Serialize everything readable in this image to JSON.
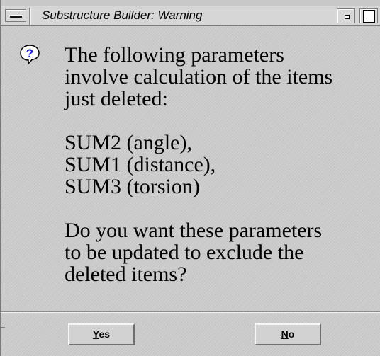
{
  "window": {
    "title": "Substructure Builder: Warning"
  },
  "icons": {
    "question": "question-icon",
    "question_glyph": "?",
    "question_color": "#1f1fd8"
  },
  "message": {
    "line1": "The following parameters",
    "line2": "involve calculation of the items",
    "line3": "just deleted:",
    "params": [
      "SUM2 (angle),",
      "SUM1 (distance),",
      "SUM3 (torsion)"
    ],
    "question1": "Do you want these parameters",
    "question2": "to be updated to exclude the",
    "question3": "deleted items?"
  },
  "buttons": {
    "yes_mnemonic": "Y",
    "yes_rest": "es",
    "no_mnemonic": "N",
    "no_rest": "o"
  }
}
